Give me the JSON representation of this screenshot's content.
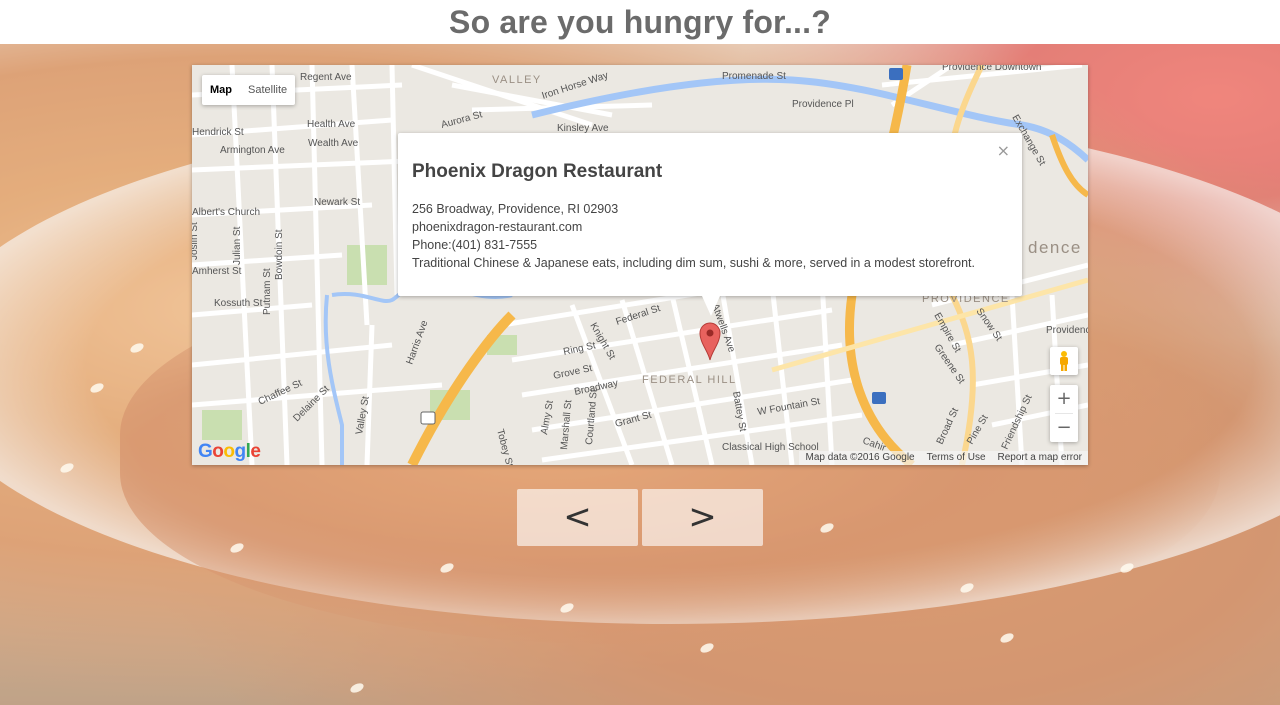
{
  "page": {
    "title": "So are you hungry for...?"
  },
  "map": {
    "type_controls": {
      "map": "Map",
      "satellite": "Satellite"
    },
    "zoom": {
      "in": "+",
      "out": "−"
    },
    "attribution": {
      "data": "Map data ©2016 Google",
      "terms": "Terms of Use",
      "report": "Report a map error"
    },
    "logo": {
      "g1": "G",
      "o1": "o",
      "o2": "o",
      "g2": "g",
      "l": "l",
      "e": "e"
    },
    "district_labels": [
      "VALLEY",
      "FEDERAL HILL",
      "PROVIDENCE",
      "dence"
    ],
    "street_labels": [
      "Regent Ave",
      "Iron Horse Way",
      "Promenade St",
      "Providence Downtown",
      "Hendrick St",
      "Health Ave",
      "Aurora St",
      "Kinsley Ave",
      "Providence Pl",
      "Armington Ave",
      "Wealth Ave",
      "Exchange St",
      "Newark St",
      "Albert's Church",
      "Joslin St",
      "Julian St",
      "Bowdoin St",
      "Amherst St",
      "Putnam St",
      "Kossuth St",
      "Harris Ave",
      "Knight St",
      "Federal St",
      "Ring St",
      "Grove St",
      "Broadway",
      "Atwells Ave",
      "Chaffee St",
      "Delaine St",
      "Valley St",
      "Tobey St",
      "Almy St",
      "Marshall St",
      "Courtland St",
      "Grant St",
      "Battey St",
      "W Fountain St",
      "Classical High School",
      "Broad St",
      "Empire St",
      "Greene St",
      "Snow St",
      "Pine St",
      "Friendship St",
      "Providence Arts Center",
      "Cahir"
    ]
  },
  "infowindow": {
    "name": "Phoenix Dragon Restaurant",
    "address": "256 Broadway, Providence, RI 02903",
    "website": "phoenixdragon-restaurant.com",
    "phone": "Phone:(401) 831-7555",
    "description": "Traditional Chinese & Japanese eats, including dim sum, sushi & more, served in a modest storefront.",
    "close": "×"
  },
  "nav": {
    "prev": "<",
    "next": ">"
  },
  "colors": {
    "highway": "#f6b84a",
    "water": "#a3c6f7",
    "park": "#c9dfb0",
    "map_bg": "#ebe8e2",
    "pin": "#e8625e"
  }
}
